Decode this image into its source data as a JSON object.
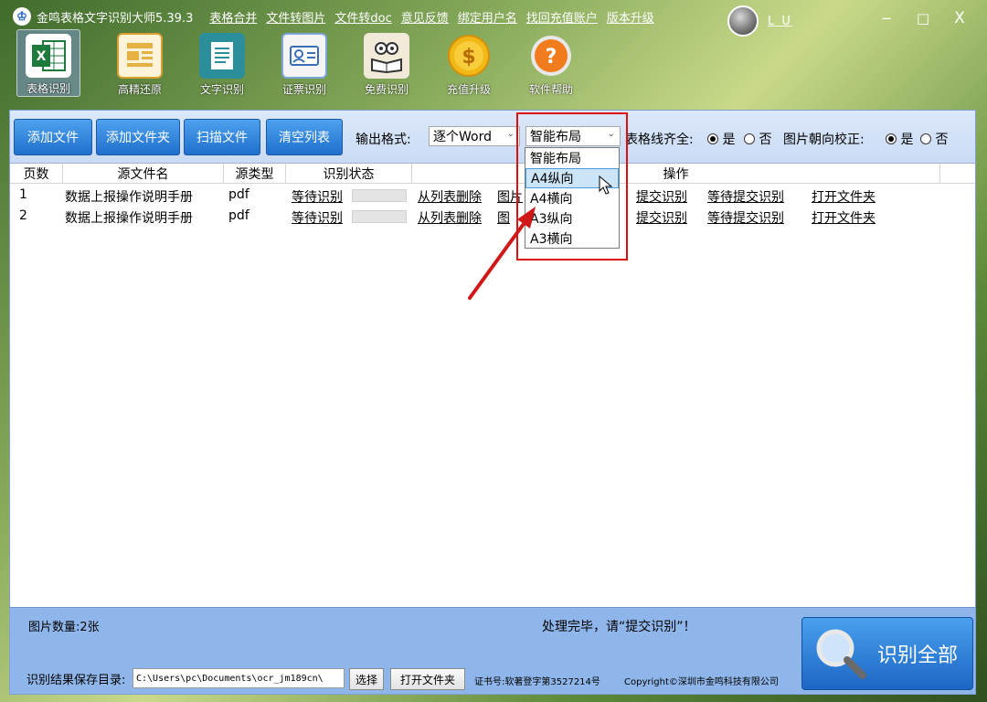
{
  "titlebar": {
    "title": "金鸣表格文字识别大师5.39.3",
    "menu": [
      "表格合并",
      "文件转图片",
      "文件转doc",
      "意见反馈",
      "绑定用户名",
      "找回充值账户",
      "版本升级"
    ],
    "username": "L U",
    "minimize": "−",
    "maximize": "□",
    "close": "X"
  },
  "toolbar": [
    {
      "label": "表格识别",
      "icon": "excel-icon"
    },
    {
      "label": "高精还原",
      "icon": "layout-icon"
    },
    {
      "label": "文字识别",
      "icon": "document-icon"
    },
    {
      "label": "证票识别",
      "icon": "id-card-icon"
    },
    {
      "label": "免费识别",
      "icon": "owl-book-icon"
    },
    {
      "label": "充值升级",
      "icon": "dollar-coin-icon"
    },
    {
      "label": "软件帮助",
      "icon": "help-icon"
    }
  ],
  "buttons": {
    "add_file": "添加文件",
    "add_folder": "添加文件夹",
    "scan_file": "扫描文件",
    "clear_list": "清空列表"
  },
  "options": {
    "output_format_label": "输出格式:",
    "output_format_value": "逐个Word",
    "layout_value": "智能布局",
    "table_align_label": "表格线齐全:",
    "orientation_label": "图片朝向校正:",
    "yes": "是",
    "no": "否"
  },
  "dropdown": {
    "items": [
      "智能布局",
      "A4纵向",
      "A4横向",
      "A3纵向",
      "A3横向"
    ],
    "highlighted": "A4纵向"
  },
  "table": {
    "headers": [
      "页数",
      "源文件名",
      "源类型",
      "识别状态",
      "操作"
    ],
    "rows": [
      {
        "page": "1",
        "name": "数据上报操作说明手册",
        "type": "pdf",
        "status": "等待识别",
        "op1": "从列表删除",
        "op2": "图片",
        "op3": "提交识别",
        "op4": "等待提交识别",
        "op5": "打开文件夹"
      },
      {
        "page": "2",
        "name": "数据上报操作说明手册",
        "type": "pdf",
        "status": "等待识别",
        "op1": "从列表删除",
        "op2": "图",
        "op3": "提交识别",
        "op4": "等待提交识别",
        "op5": "打开文件夹"
      }
    ]
  },
  "status": {
    "image_count": "图片数量:2张",
    "message": "处理完毕，请“提交识别”！",
    "save_dir_label": "识别结果保存目录:",
    "save_dir_value": "C:\\Users\\pc\\Documents\\ocr_jm189cn\\",
    "choose": "选择",
    "open_folder": "打开文件夹",
    "cert": "证书号:软著登字第3527214号",
    "copyright": "Copyright©深圳市金鸣科技有限公司",
    "recognize_all": "识别全部"
  }
}
